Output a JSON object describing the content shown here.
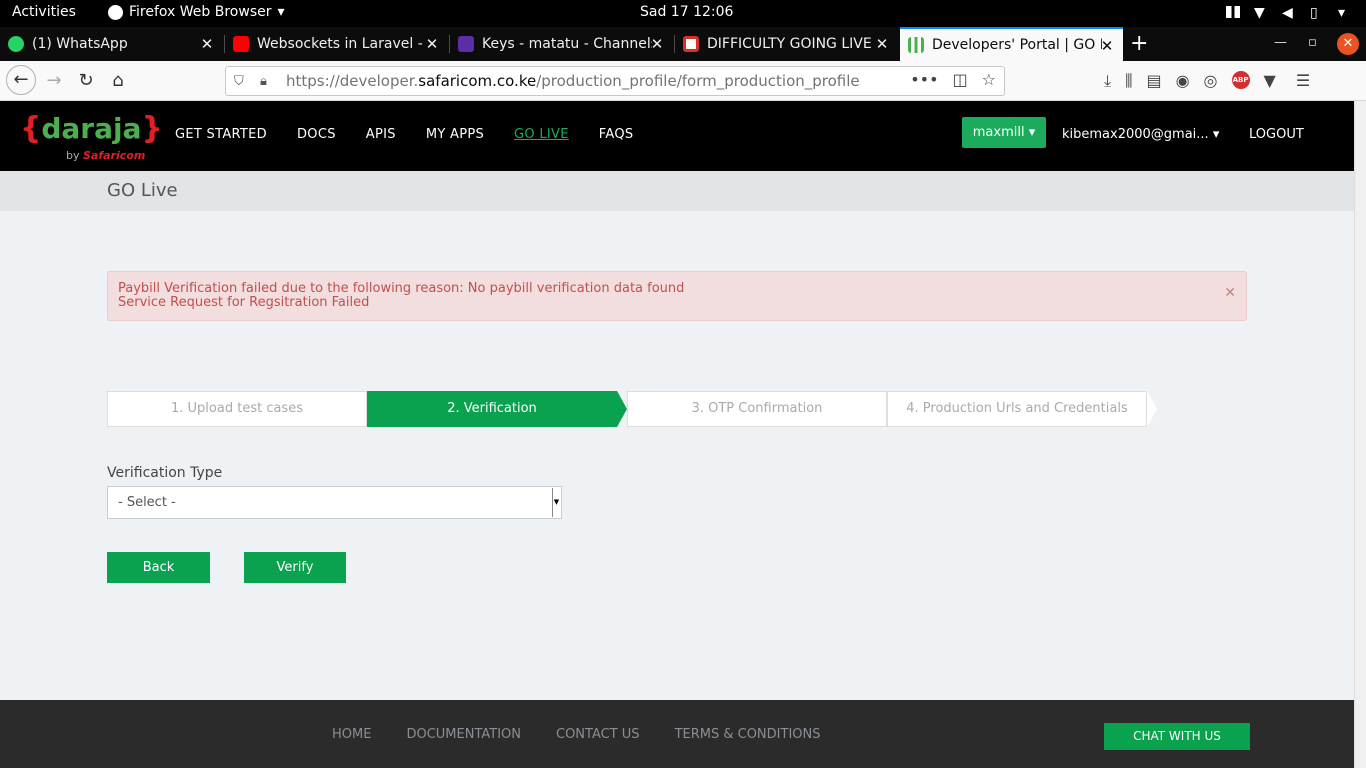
{
  "os_bar": {
    "activities": "Activities",
    "app_menu": "Firefox Web Browser",
    "clock": "Sad 17  12:06"
  },
  "tabs": [
    {
      "title": "(1) WhatsApp",
      "favicon_color": "#25d366"
    },
    {
      "title": "Websockets in Laravel - F",
      "favicon_color": "#ff0000"
    },
    {
      "title": "Keys - matatu - Channels",
      "favicon_color": "#5b2da8"
    },
    {
      "title": "DIFFICULTY GOING LIVE",
      "favicon_color": "#d93025"
    },
    {
      "title": "Developers' Portal | GO L",
      "favicon_color": "#4caf50"
    }
  ],
  "urlbar": {
    "prefix": "https://developer.",
    "domain": "safaricom.co.ke",
    "path": "/production_profile/form_production_profile"
  },
  "site": {
    "logo_brace_open": "{",
    "logo_word": "daraja",
    "logo_brace_close": "}",
    "logo_by": "by",
    "logo_brand": "Safaricom",
    "nav": [
      "GET STARTED",
      "DOCS",
      "APIS",
      "MY APPS",
      "GO LIVE",
      "FAQS"
    ],
    "user_button": "maxmill",
    "email": "kibemax2000@gmai...",
    "logout": "LOGOUT"
  },
  "page": {
    "title": "GO Live",
    "alert_line1": "Paybill Verification failed due to the following reason: No paybill verification data found",
    "alert_line2": "Service Request for Regsitration Failed",
    "steps": [
      "1. Upload test cases",
      "2. Verification",
      "3. OTP Confirmation",
      "4. Production Urls and Credentials"
    ],
    "active_step": 2,
    "field_label": "Verification Type",
    "select_value": "- Select -",
    "back_button": "Back",
    "verify_button": "Verify"
  },
  "footer": {
    "links": [
      "HOME",
      "DOCUMENTATION",
      "CONTACT US",
      "TERMS & CONDITIONS"
    ],
    "chat_button": "CHAT WITH US"
  },
  "colors": {
    "accent_green": "#0aa14f",
    "alert_bg": "#f2dede",
    "alert_text": "#c0504d"
  }
}
